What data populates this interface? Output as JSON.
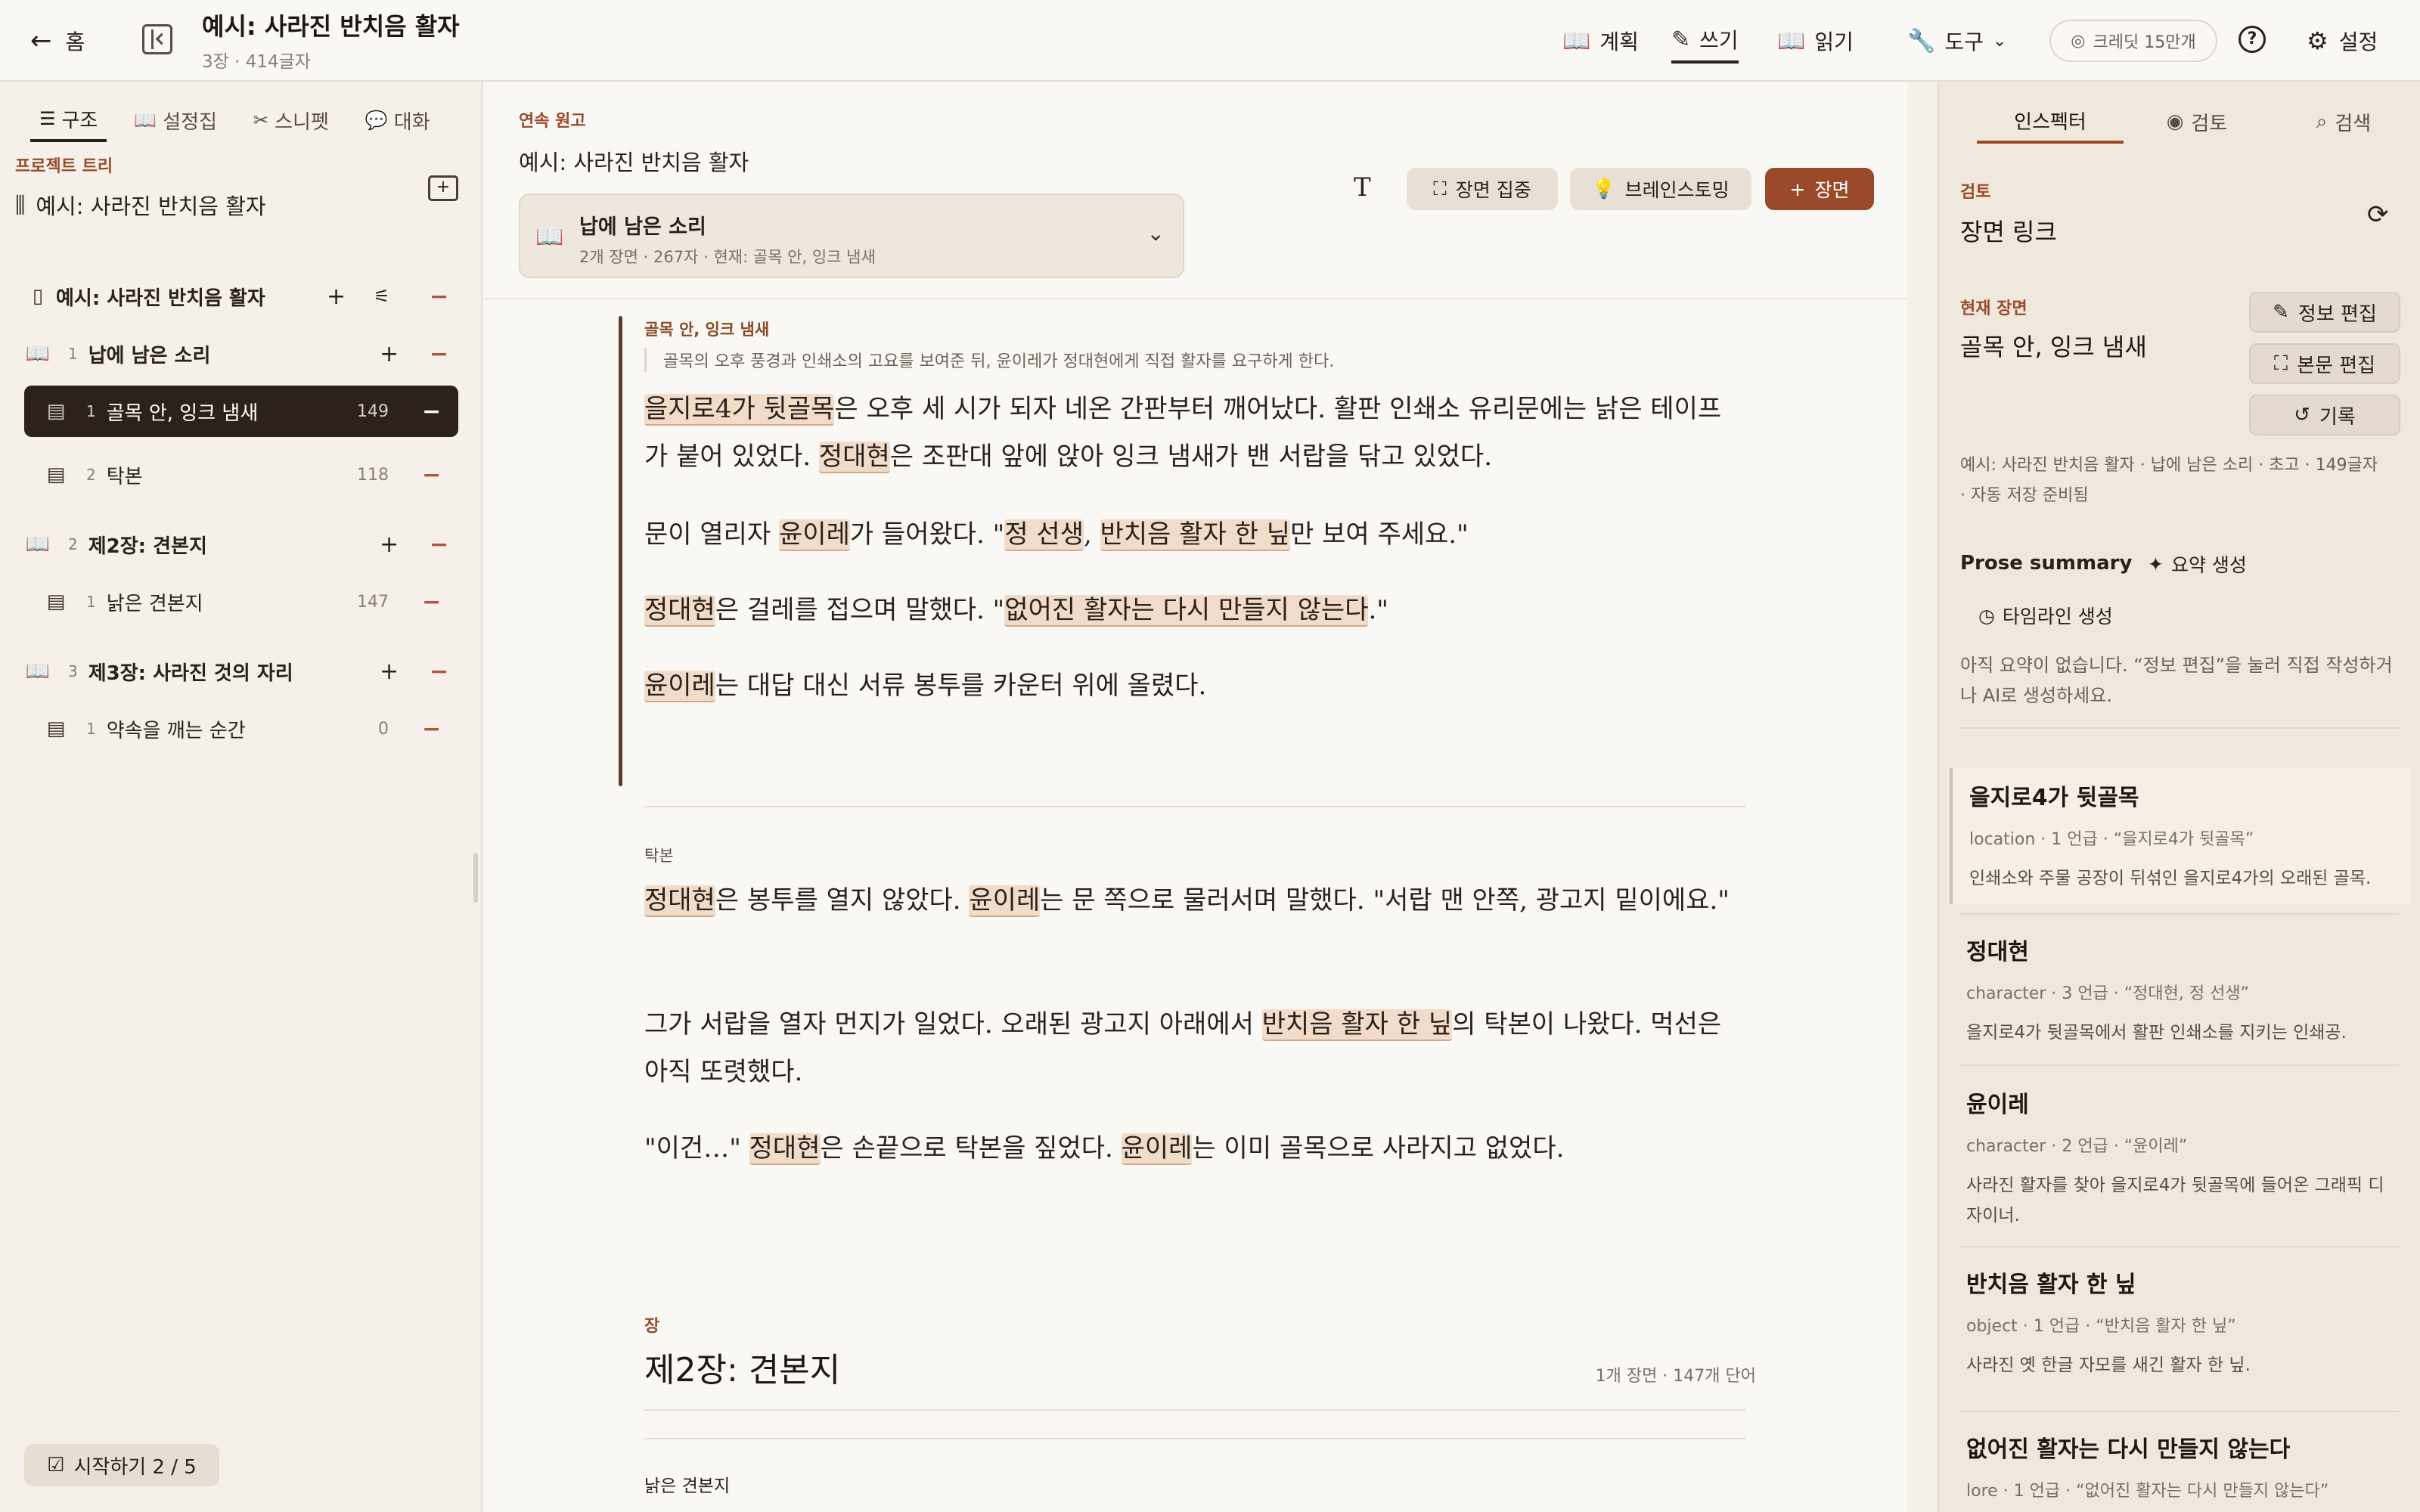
{
  "topbar": {
    "home": "홈",
    "title": "예시: 사라진 반치음 활자",
    "subtitle": "3장 · 414글자",
    "nav": {
      "plan": "계획",
      "write": "쓰기",
      "read": "읽기",
      "tools": "도구"
    },
    "credit": "크레딧 15만개",
    "help": "?",
    "settings": "설정"
  },
  "left": {
    "tabs": [
      "구조",
      "설정집",
      "스니펫",
      "대화"
    ],
    "tree_label": "프로젝트 트리",
    "project_name": "예시: 사라진 반치음 활자",
    "book": {
      "title": "예시: 사라진 반치음 활자"
    },
    "chapters": [
      {
        "num": "1",
        "title": "납에 남은 소리",
        "scenes": [
          {
            "num": "1",
            "title": "골목 안, 잉크 냄새",
            "count": "149"
          },
          {
            "num": "2",
            "title": "탁본",
            "count": "118"
          }
        ]
      },
      {
        "num": "2",
        "title": "제2장: 견본지",
        "scenes": [
          {
            "num": "1",
            "title": "낡은 견본지",
            "count": "147"
          }
        ]
      },
      {
        "num": "3",
        "title": "제3장: 사라진 것의 자리",
        "scenes": [
          {
            "num": "1",
            "title": "약속을 깨는 순간",
            "count": "0"
          }
        ]
      }
    ],
    "start": "시작하기 2 / 5"
  },
  "main": {
    "label": "연속 원고",
    "doc_title": "예시: 사라진 반치음 활자",
    "chapter_box": {
      "title": "납에 남은 소리",
      "meta": "2개 장면 · 267자 · 현재: 골목 안, 잉크 냄새"
    },
    "buttons": {
      "focus": "장면 집중",
      "brainstorm": "브레인스토밍",
      "add_scene": "장면"
    },
    "scene1": {
      "heading": "골목 안, 잉크 냄새",
      "desc": "골목의 오후 풍경과 인쇄소의 고요를 보여준 뒤, 윤이레가 정대현에게 직접 활자를 요구하게 한다.",
      "p1": [
        "을지로4가 뒷골목",
        "은 오후 세 시가 되자 네온 간판부터 깨어났다. 활판 인쇄소 유리문에는 낡은 테이프가 붙어 있었다. ",
        "정대현",
        "은 조판대 앞에 앉아 잉크 냄새가 밴 서랍을 닦고 있었다."
      ],
      "p2": [
        "문이 열리자 ",
        "윤이레",
        "가 들어왔다. \"",
        "정 선생",
        ", ",
        "반치음 활자 한 닢",
        "만 보여 주세요.\""
      ],
      "p3": [
        "정대현",
        "은 걸레를 접으며 말했다. \"",
        "없어진 활자는 다시 만들지 않는다",
        ".\""
      ],
      "p4": [
        "윤이레",
        "는 대답 대신 서류 봉투를 카운터 위에 올렸다."
      ]
    },
    "scene2": {
      "heading": "탁본",
      "p1": [
        "정대현",
        "은 봉투를 열지 않았다. ",
        "윤이레",
        "는 문 쪽으로 물러서며 말했다. \"서랍 맨 안쪽, 광고지 밑이에요.\""
      ],
      "p2": [
        "그가 서랍을 열자 먼지가 일었다. 오래된 광고지 아래에서 ",
        "반치음 활자 한 닢",
        "의 탁본이 나왔다. 먹선은 아직 또렷했다."
      ],
      "p3": [
        "\"이건…\" ",
        "정대현",
        "은 손끝으로 탁본을 짚었다. ",
        "윤이레",
        "는 이미 골목으로 사라지고 없었다."
      ]
    },
    "chapter2": {
      "label": "장",
      "title": "제2장: 견본지",
      "meta": "1개 장면 · 147개 단어",
      "scene": "낡은 견본지"
    }
  },
  "right": {
    "tabs": [
      "인스펙터",
      "검토",
      "검색"
    ],
    "review_label": "검토",
    "review_title": "장면 링크",
    "current_label": "현재 장면",
    "current_title": "골목 안, 잉크 냄새",
    "buttons": {
      "edit_info": "정보 편집",
      "edit_body": "본문 편집",
      "history": "기록"
    },
    "meta": "예시: 사라진 반치음 활자 · 납에 남은 소리 · 초고 · 149글자 · 자동 저장 준비됨",
    "summary_label": "Prose summary",
    "gen_summary": "요약 생성",
    "gen_timeline": "타임라인 생성",
    "empty": "아직 요약이 없습니다. “정보 편집”을 눌러 직접 작성하거나 AI로 생성하세요.",
    "entities": [
      {
        "name": "을지로4가 뒷골목",
        "meta": "location · 1 언급 · “을지로4가 뒷골목”",
        "desc": "인쇄소와 주물 공장이 뒤섞인 을지로4가의 오래된 골목."
      },
      {
        "name": "정대현",
        "meta": "character · 3 언급 · “정대현, 정 선생”",
        "desc": "을지로4가 뒷골목에서 활판 인쇄소를 지키는 인쇄공."
      },
      {
        "name": "윤이레",
        "meta": "character · 2 언급 · “윤이레”",
        "desc": "사라진 활자를 찾아 을지로4가 뒷골목에 들어온 그래픽 디자이너."
      },
      {
        "name": "반치음 활자 한 닢",
        "meta": "object · 1 언급 · “반치음 활자 한 닢”",
        "desc": "사라진 옛 한글 자모를 새긴 활자 한 닢."
      },
      {
        "name": "없어진 활자는 다시 만들지 않는다",
        "meta": "lore · 1 언급 · “없어진 활자는 다시 만들지 않는다”",
        "desc": ""
      }
    ]
  },
  "colors": {
    "accent": "#9a4a2a",
    "highlight": "#f0dcc9",
    "selected_row": "#2c221b"
  }
}
